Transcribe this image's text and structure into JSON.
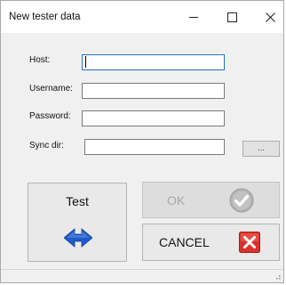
{
  "window": {
    "title": "New tester data",
    "controls": {
      "minimize": "minimize-icon",
      "maximize": "maximize-icon",
      "close": "close-icon"
    }
  },
  "form": {
    "host_label": "Host:",
    "host_value": "",
    "username_label": "Username:",
    "username_value": "",
    "password_label": "Password:",
    "password_value": "",
    "sync_dir_label": "Sync dir:",
    "sync_dir_value": "",
    "browse_label": "..."
  },
  "buttons": {
    "test_label": "Test",
    "test_icon": "left-right-arrows-icon",
    "ok_label": "OK",
    "ok_enabled": false,
    "ok_icon": "checkmark-icon",
    "cancel_label": "CANCEL",
    "cancel_icon": "red-x-icon"
  },
  "colors": {
    "focus_border": "#2a6fc9",
    "arrow_blue": "#1f5bc9",
    "cancel_red": "#d9322a",
    "ok_disabled_text": "#a8a8a8"
  }
}
